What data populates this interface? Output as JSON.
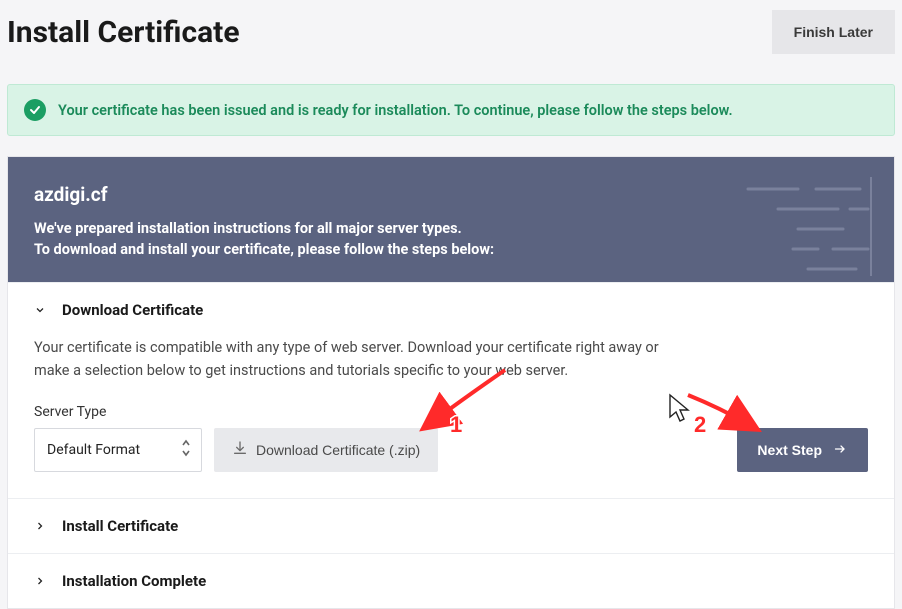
{
  "header": {
    "title": "Install Certificate",
    "finish_later": "Finish Later"
  },
  "alert": {
    "text": "Your certificate has been issued and is ready for installation. To continue, please follow the steps below."
  },
  "hero": {
    "domain": "azdigi.cf",
    "line1": "We've prepared installation instructions for all major server types.",
    "line2": "To download and install your certificate, please follow the steps below:"
  },
  "section_download": {
    "title": "Download Certificate",
    "desc": "Your certificate is compatible with any type of web server. Download your certificate right away or make a selection below to get instructions and tutorials specific to your web server.",
    "server_type_label": "Server Type",
    "server_type_value": "Default Format",
    "download_button": "Download Certificate (.zip)",
    "next_button": "Next Step"
  },
  "section_install": {
    "title": "Install Certificate"
  },
  "section_complete": {
    "title": "Installation Complete"
  },
  "annotations": {
    "num1": "1",
    "num2": "2"
  }
}
